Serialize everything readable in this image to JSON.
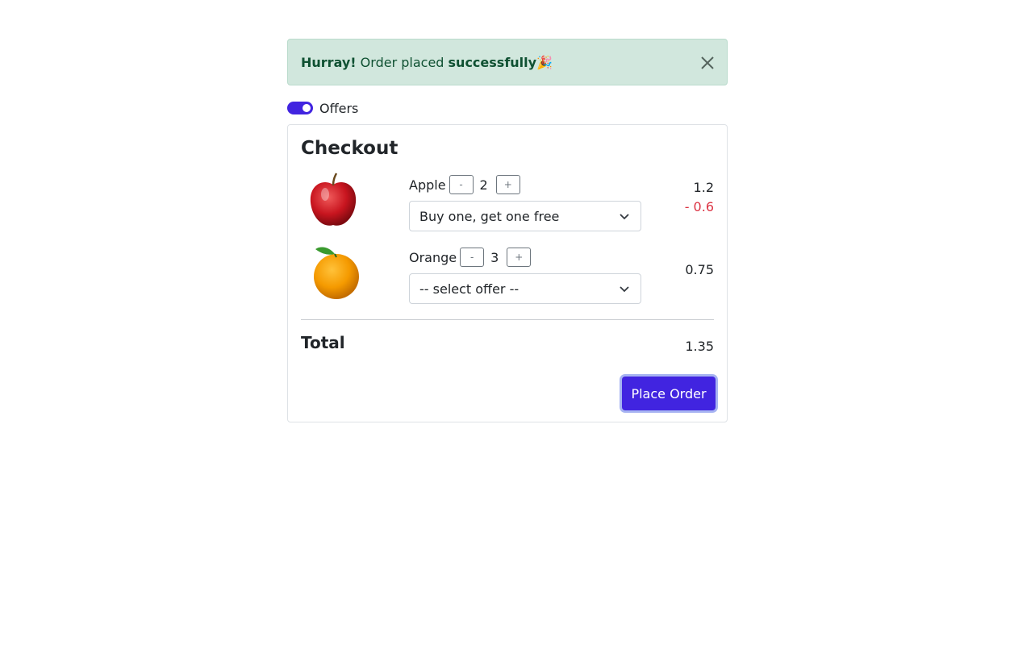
{
  "alert": {
    "strong": "Hurray!",
    "text": " Order placed ",
    "strong2": "successfully",
    "emoji": "🎉",
    "close_icon": "close-icon"
  },
  "offers_toggle": {
    "label": "Offers",
    "on": true
  },
  "checkout": {
    "title": "Checkout",
    "items": [
      {
        "name": "Apple",
        "minus": "-",
        "qty": "2",
        "plus": "+",
        "offer": "Buy one, get one free",
        "price": "1.2",
        "discount": "- 0.6",
        "image_icon": "apple-image"
      },
      {
        "name": "Orange",
        "minus": "-",
        "qty": "3",
        "plus": "+",
        "offer": "-- select offer --",
        "price": "0.75",
        "discount": "",
        "image_icon": "orange-image"
      }
    ],
    "total_label": "Total",
    "total_value": "1.35",
    "place_order": "Place Order"
  },
  "colors": {
    "accent": "#4124e0",
    "alert_bg": "#d1e7dd",
    "alert_text": "#0f5132",
    "discount": "#dc3545"
  }
}
